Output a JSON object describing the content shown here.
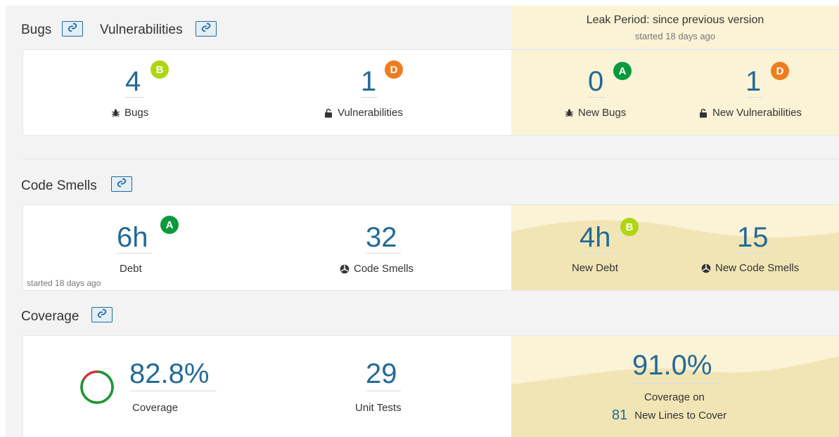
{
  "leak_period": {
    "title": "Leak Period: since previous version",
    "subtitle": "started 18 days ago"
  },
  "sections": {
    "bugs_title": "Bugs",
    "vulns_title": "Vulnerabilities",
    "smells_title": "Code Smells",
    "coverage_title": "Coverage"
  },
  "bugs": {
    "bugs": {
      "value": "4",
      "rating": "B",
      "label": "Bugs"
    },
    "vulnerabilities": {
      "value": "1",
      "rating": "D",
      "label": "Vulnerabilities"
    },
    "new_bugs": {
      "value": "0",
      "rating": "A",
      "label": "New Bugs"
    },
    "new_vulnerabilities": {
      "value": "1",
      "rating": "D",
      "label": "New Vulnerabilities"
    }
  },
  "smells": {
    "debt": {
      "value": "6h",
      "rating": "A",
      "label": "Debt"
    },
    "started": "started 18 days ago",
    "code_smells": {
      "value": "32",
      "label": "Code Smells"
    },
    "new_debt": {
      "value": "4h",
      "rating": "B",
      "label": "New Debt"
    },
    "new_code_smells": {
      "value": "15",
      "label": "New Code Smells"
    }
  },
  "coverage": {
    "coverage": {
      "value": "82.8%",
      "label": "Coverage",
      "percent": 82.8
    },
    "unit_tests": {
      "value": "29",
      "label": "Unit Tests"
    },
    "new_coverage": {
      "value": "91.0%",
      "label": "Coverage on",
      "lines_value": "81",
      "lines_label": "New Lines to Cover"
    }
  },
  "colors": {
    "rating_A": "#0a9a3c",
    "rating_B": "#b0d513",
    "rating_D": "#ed7d20",
    "accent": "#236a97",
    "leak_bg": "#fbf3d5",
    "coverage_ok": "#1a9a35",
    "coverage_bad": "#d4333f"
  },
  "icons": {
    "link": "link-icon",
    "bug": "bug-icon",
    "lock": "lock-icon",
    "smell": "code-smell-icon"
  }
}
